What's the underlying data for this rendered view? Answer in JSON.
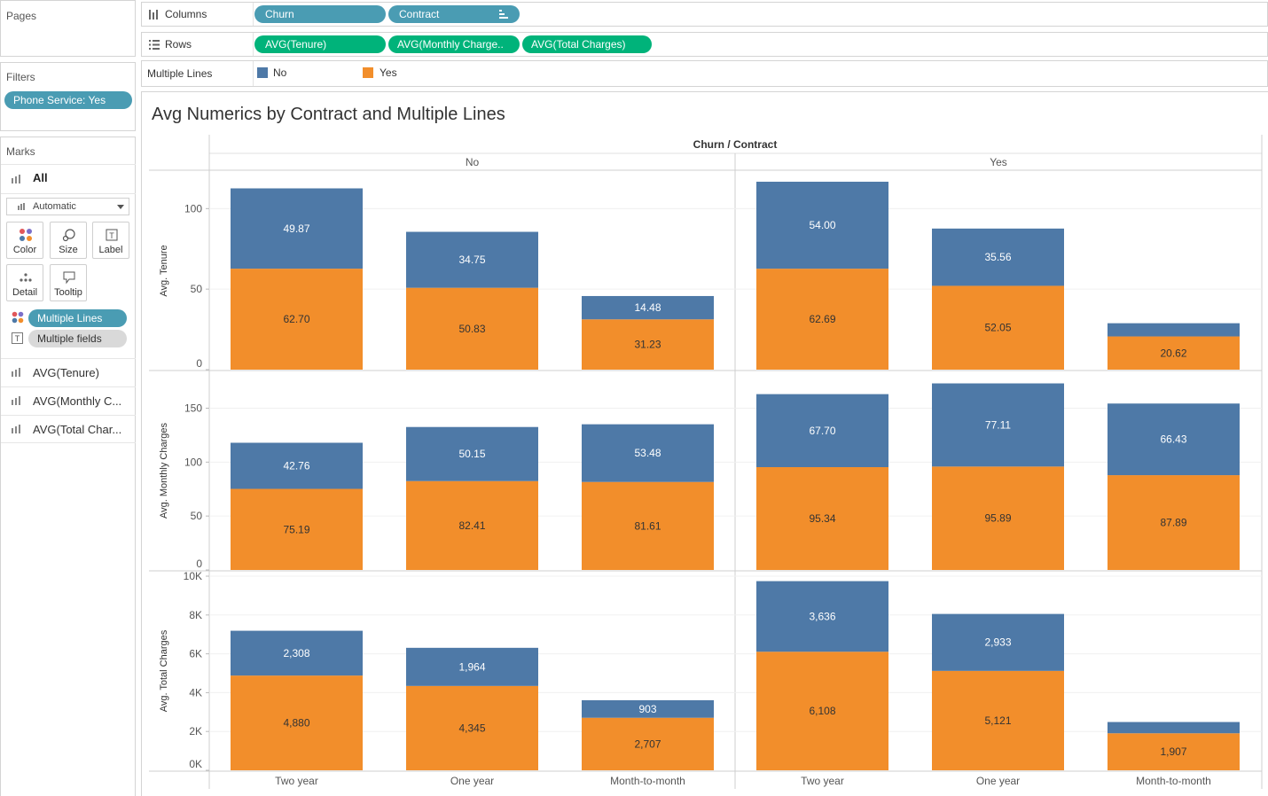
{
  "pages_panel": {
    "title": "Pages"
  },
  "filters_panel": {
    "title": "Filters",
    "pills": [
      "Phone Service: Yes"
    ]
  },
  "marks_panel": {
    "title": "Marks",
    "all_label": "All",
    "mark_type": "Automatic",
    "buttons": {
      "color": "Color",
      "size": "Size",
      "label": "Label",
      "detail": "Detail",
      "tooltip": "Tooltip"
    },
    "encodings": {
      "color_field": "Multiple Lines",
      "label_field": "Multiple fields"
    },
    "measures": [
      "AVG(Tenure)",
      "AVG(Monthly C...",
      "AVG(Total Char..."
    ]
  },
  "shelves": {
    "columns": {
      "label": "Columns",
      "pills": [
        "Churn",
        "Contract"
      ]
    },
    "rows": {
      "label": "Rows",
      "pills": [
        "AVG(Tenure)",
        "AVG(Monthly Charge..",
        "AVG(Total Charges)"
      ]
    },
    "legend": {
      "label": "Multiple Lines",
      "items": [
        {
          "name": "No",
          "color": "#4e79a7"
        },
        {
          "name": "Yes",
          "color": "#f28e2b"
        }
      ]
    }
  },
  "chart_data": {
    "type": "bar",
    "stacked": true,
    "title": "Avg Numerics by Contract and Multiple Lines",
    "column_header": "Churn / Contract",
    "panes": [
      "No",
      "Yes"
    ],
    "categories": [
      "Two year",
      "One year",
      "Month-to-month"
    ],
    "colors": {
      "No": "#4e79a7",
      "Yes": "#f28e2b"
    },
    "rows": [
      {
        "ylabel": "Avg. Tenure",
        "ylim": [
          0,
          120
        ],
        "ticks": [
          0,
          50,
          100
        ],
        "tick_labels": [
          "0",
          "50",
          "100"
        ],
        "series": [
          {
            "name": "Yes",
            "values": [
              [
                62.7,
                50.83,
                31.23
              ],
              [
                62.69,
                52.05,
                20.62
              ]
            ],
            "labels": [
              [
                "62.70",
                "50.83",
                "31.23"
              ],
              [
                "62.69",
                "52.05",
                "20.62"
              ]
            ]
          },
          {
            "name": "No",
            "values": [
              [
                49.87,
                34.75,
                14.48
              ],
              [
                54.0,
                35.56,
                8.2
              ]
            ],
            "labels": [
              [
                "49.87",
                "34.75",
                "14.48"
              ],
              [
                "54.00",
                "35.56",
                ""
              ]
            ]
          }
        ]
      },
      {
        "ylabel": "Avg. Monthly Charges",
        "ylim": [
          0,
          180
        ],
        "ticks": [
          0,
          50,
          100,
          150
        ],
        "tick_labels": [
          "0",
          "50",
          "100",
          "150"
        ],
        "series": [
          {
            "name": "Yes",
            "values": [
              [
                75.19,
                82.41,
                81.61
              ],
              [
                95.34,
                95.89,
                87.89
              ]
            ],
            "labels": [
              [
                "75.19",
                "82.41",
                "81.61"
              ],
              [
                "95.34",
                "95.89",
                "87.89"
              ]
            ]
          },
          {
            "name": "No",
            "values": [
              [
                42.76,
                50.15,
                53.48
              ],
              [
                67.7,
                77.11,
                66.43
              ]
            ],
            "labels": [
              [
                "42.76",
                "50.15",
                "53.48"
              ],
              [
                "67.70",
                "77.11",
                "66.43"
              ]
            ]
          }
        ]
      },
      {
        "ylabel": "Avg. Total Charges",
        "ylim": [
          0,
          10000
        ],
        "ticks": [
          0,
          2000,
          4000,
          6000,
          8000,
          10000
        ],
        "tick_labels": [
          "0K",
          "2K",
          "4K",
          "6K",
          "8K",
          "10K"
        ],
        "series": [
          {
            "name": "Yes",
            "values": [
              [
                4880,
                4345,
                2707
              ],
              [
                6108,
                5121,
                1907
              ]
            ],
            "labels": [
              [
                "4,880",
                "4,345",
                "2,707"
              ],
              [
                "6,108",
                "5,121",
                "1,907"
              ]
            ]
          },
          {
            "name": "No",
            "values": [
              [
                2308,
                1964,
                903
              ],
              [
                3636,
                2933,
                580
              ]
            ],
            "labels": [
              [
                "2,308",
                "1,964",
                "903"
              ],
              [
                "3,636",
                "2,933",
                ""
              ]
            ]
          }
        ]
      }
    ]
  }
}
